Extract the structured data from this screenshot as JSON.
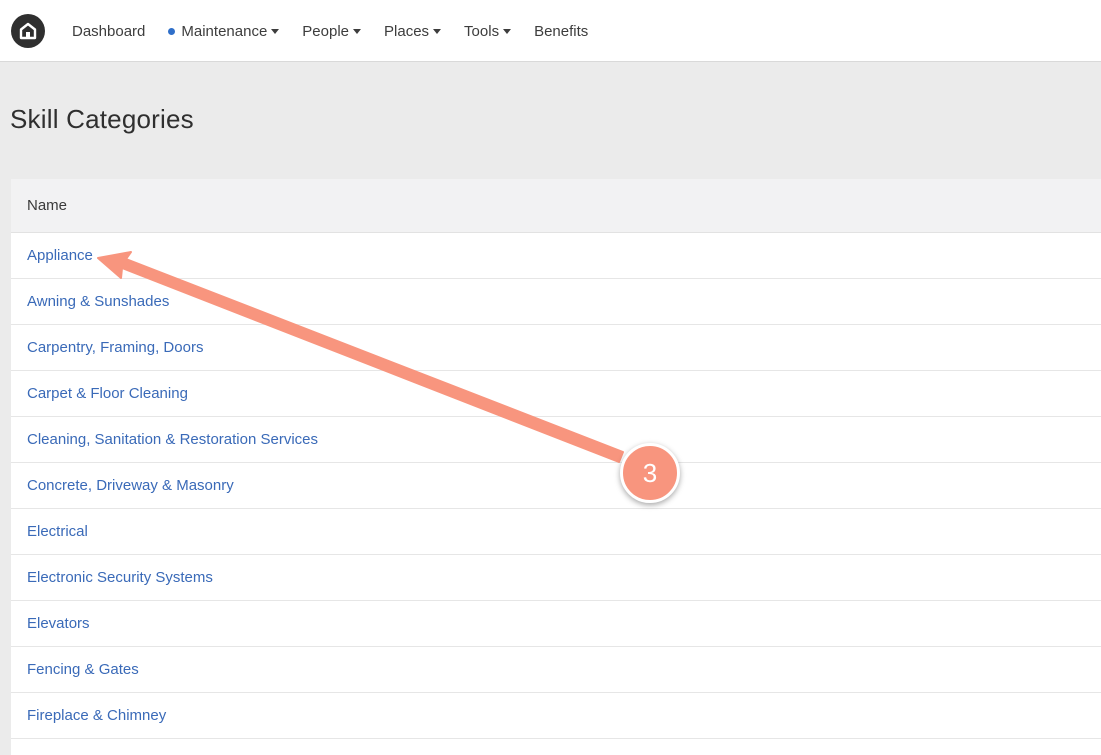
{
  "navbar": {
    "logo_icon": "home-icon",
    "items": [
      {
        "label": "Dashboard",
        "dropdown": false,
        "active_dot": false
      },
      {
        "label": "Maintenance",
        "dropdown": true,
        "active_dot": true
      },
      {
        "label": "People",
        "dropdown": true,
        "active_dot": false
      },
      {
        "label": "Places",
        "dropdown": true,
        "active_dot": false
      },
      {
        "label": "Tools",
        "dropdown": true,
        "active_dot": false
      },
      {
        "label": "Benefits",
        "dropdown": false,
        "active_dot": false
      }
    ]
  },
  "page": {
    "title": "Skill Categories"
  },
  "table": {
    "header": "Name",
    "rows": [
      "Appliance",
      "Awning & Sunshades",
      "Carpentry, Framing, Doors",
      "Carpet & Floor Cleaning",
      "Cleaning, Sanitation & Restoration Services",
      "Concrete, Driveway & Masonry",
      "Electrical",
      "Electronic Security Systems",
      "Elevators",
      "Fencing & Gates",
      "Fireplace & Chimney"
    ]
  },
  "annotation": {
    "step_number": "3",
    "color": "#f8957e",
    "arrow_icon": "arrow-pointer"
  },
  "colors": {
    "link": "#3a6ab8",
    "active_dot": "#2f6fc9",
    "background": "#ebebeb"
  }
}
